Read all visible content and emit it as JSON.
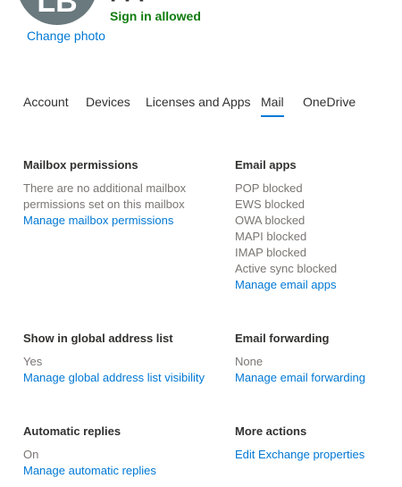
{
  "user": {
    "initials": "LB",
    "status": "Sign in allowed",
    "change_photo": "Change photo"
  },
  "tabs": [
    "Account",
    "Devices",
    "Licenses and Apps",
    "Mail",
    "OneDrive"
  ],
  "active_tab": "Mail",
  "colors": {
    "accent": "#0078d4",
    "success": "#107c10",
    "avatar_bg": "#69797e",
    "muted_text": "#7a7574"
  },
  "mailbox_permissions": {
    "title": "Mailbox permissions",
    "line1": "There are no additional mailbox",
    "line2": "permissions set on this mailbox",
    "link": "Manage mailbox permissions"
  },
  "email_apps": {
    "title": "Email apps",
    "items": [
      "POP blocked",
      "EWS blocked",
      "OWA blocked",
      "MAPI blocked",
      "IMAP blocked",
      "Active sync blocked"
    ],
    "link": "Manage email apps"
  },
  "global_address_list": {
    "title": "Show in global address list",
    "value": "Yes",
    "link": "Manage global address list visibility"
  },
  "email_forwarding": {
    "title": "Email forwarding",
    "value": "None",
    "link": "Manage email forwarding"
  },
  "automatic_replies": {
    "title": "Automatic replies",
    "value": "On",
    "link": "Manage automatic replies"
  },
  "more_actions": {
    "title": "More actions",
    "link": "Edit Exchange properties"
  }
}
